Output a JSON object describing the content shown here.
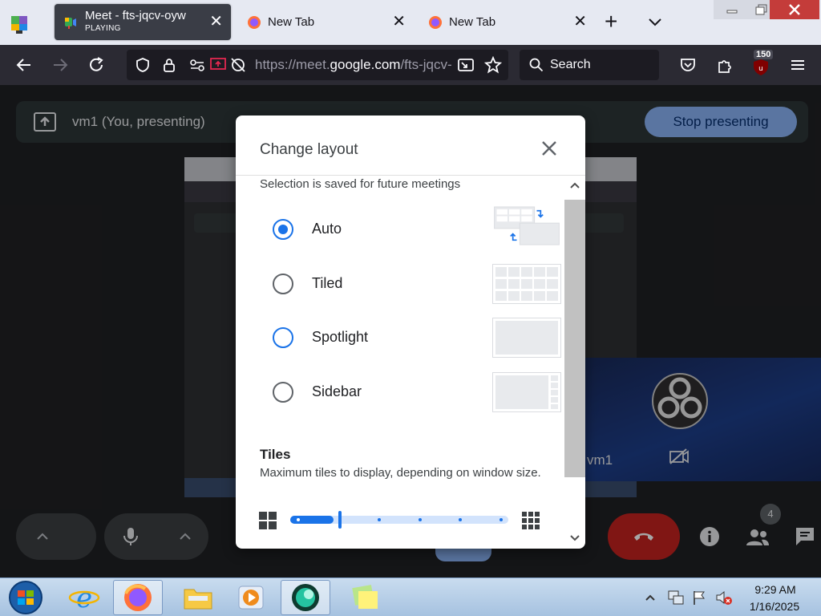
{
  "browser": {
    "tabs": [
      {
        "title": "Meet - fts-jqcv-oyw",
        "subtitle": "PLAYING",
        "active": true
      },
      {
        "title": "New Tab",
        "active": false
      },
      {
        "title": "New Tab",
        "active": false
      }
    ],
    "url_prefix": "https://meet.",
    "url_domain": "google.com",
    "url_suffix": "/fts-jqcv-oyw",
    "search_label": "Search",
    "extension_badge": "150"
  },
  "meet": {
    "presenting_text": "vm1 (You, presenting)",
    "stop_presenting_label": "Stop presenting",
    "tile_name": "vm1",
    "people_count": "4"
  },
  "dialog": {
    "title": "Change layout",
    "saved_note": "Selection is saved for future meetings",
    "options": [
      {
        "label": "Auto",
        "selected": true
      },
      {
        "label": "Tiled",
        "selected": false
      },
      {
        "label": "Spotlight",
        "selected": false
      },
      {
        "label": "Sidebar",
        "selected": false
      }
    ],
    "tiles_heading": "Tiles",
    "tiles_description": "Maximum tiles to display, depending on window size.",
    "tiles_slider_level": 0.2
  },
  "taskbar": {
    "time": "9:29 AM",
    "date": "1/16/2025"
  },
  "colors": {
    "meet_accent": "#8ab4f8",
    "google_blue": "#1a73e8",
    "hangup_red": "#c5221f"
  }
}
